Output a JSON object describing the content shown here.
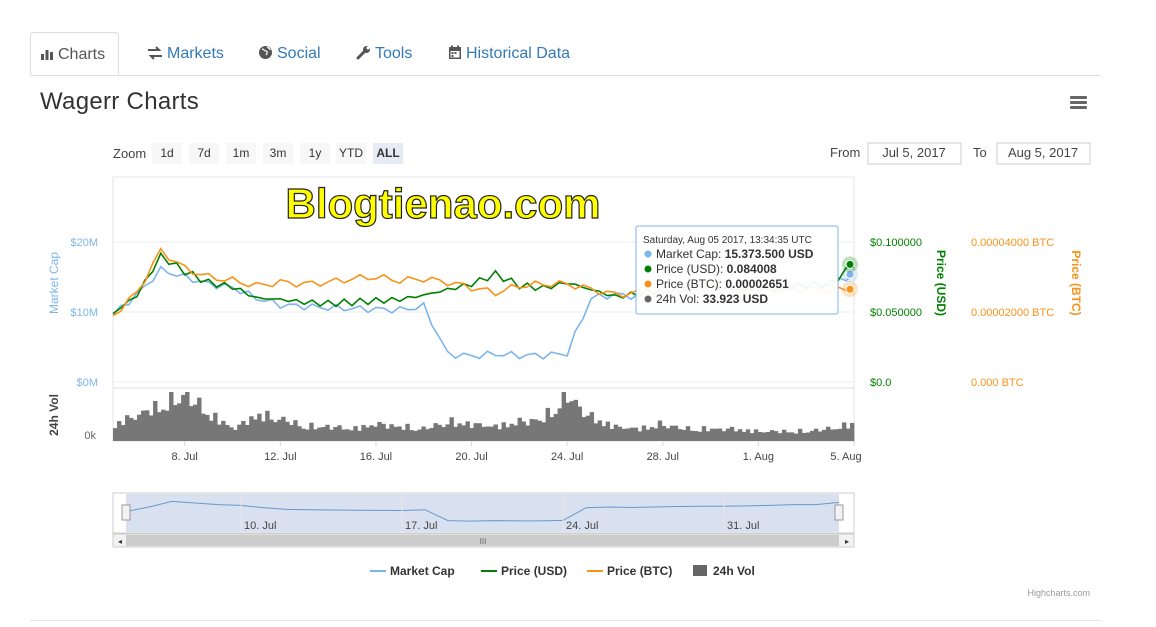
{
  "tabs": [
    {
      "label": "Charts",
      "icon": "bar-chart-icon",
      "active": true
    },
    {
      "label": "Markets",
      "icon": "exchange-arrows-icon",
      "active": false
    },
    {
      "label": "Social",
      "icon": "globe-icon",
      "active": false
    },
    {
      "label": "Tools",
      "icon": "wrench-icon",
      "active": false
    },
    {
      "label": "Historical Data",
      "icon": "calendar-icon",
      "active": false
    }
  ],
  "title": "Wagerr Charts",
  "zoom": {
    "label": "Zoom",
    "buttons": [
      "1d",
      "7d",
      "1m",
      "3m",
      "1y",
      "YTD",
      "ALL"
    ],
    "selected": "ALL"
  },
  "range": {
    "from_label": "From",
    "from_value": "Jul 5, 2017",
    "to_label": "To",
    "to_value": "Aug 5, 2017"
  },
  "watermark": "Blogtienao.com",
  "credit": "Highcharts.com",
  "colors": {
    "market_cap": "#7cb5ec",
    "price_usd": "#008000",
    "price_btc": "#f7931a",
    "volume": "#777777",
    "navigator": "#6699cc"
  },
  "tooltip": {
    "header": "Saturday, Aug 05 2017, 13:34:35 UTC",
    "rows": [
      {
        "label": "Market Cap:",
        "value": "15.373.500 USD",
        "color": "#7cb5ec"
      },
      {
        "label": "Price (USD):",
        "value": "0.084008",
        "color": "#008000"
      },
      {
        "label": "Price (BTC):",
        "value": "0.00002651",
        "color": "#f7931a"
      },
      {
        "label": "24h Vol:",
        "value": "33.923 USD",
        "color": "#666666"
      }
    ]
  },
  "chart_data": {
    "type": "line",
    "x_axis": {
      "ticks": [
        "8. Jul",
        "12. Jul",
        "16. Jul",
        "20. Jul",
        "24. Jul",
        "28. Jul",
        "1. Aug",
        "5. Aug"
      ]
    },
    "navigator_ticks": [
      "10. Jul",
      "17. Jul",
      "24. Jul",
      "31. Jul"
    ],
    "y_axes": [
      {
        "title": "Market Cap",
        "ticks": [
          "$0M",
          "$10M",
          "$20M"
        ],
        "range": [
          0,
          20000000
        ]
      },
      {
        "title": "Price (USD)",
        "ticks": [
          "$0.0",
          "$0.050000",
          "$0.100000"
        ],
        "range": [
          0,
          0.1
        ]
      },
      {
        "title": "Price (BTC)",
        "ticks": [
          "0.000 BTC",
          "0.00002000 BTC",
          "0.00004000 BTC"
        ],
        "range": [
          0,
          4e-05
        ]
      },
      {
        "title": "24h Vol",
        "ticks": [
          "0k"
        ]
      }
    ],
    "x": [
      "Jul 5",
      "Jul 6",
      "Jul 7",
      "Jul 8",
      "Jul 9",
      "Jul 10",
      "Jul 11",
      "Jul 12",
      "Jul 13",
      "Jul 14",
      "Jul 15",
      "Jul 16",
      "Jul 17",
      "Jul 18",
      "Jul 19",
      "Jul 20",
      "Jul 21",
      "Jul 22",
      "Jul 23",
      "Jul 24",
      "Jul 25",
      "Jul 26",
      "Jul 27",
      "Jul 28",
      "Jul 29",
      "Jul 30",
      "Jul 31",
      "Aug 1",
      "Aug 2",
      "Aug 3",
      "Aug 4",
      "Aug 5"
    ],
    "series": [
      {
        "name": "Market Cap",
        "axis": 0,
        "values": [
          9600000,
          12500000,
          16000000,
          15000000,
          14000000,
          13500000,
          12000000,
          11000000,
          10800000,
          10600000,
          10500000,
          10400000,
          10300000,
          10800000,
          4000000,
          3700000,
          4000000,
          3800000,
          3800000,
          4100000,
          12000000,
          12500000,
          12200000,
          12500000,
          12800000,
          13000000,
          13000000,
          13200000,
          13500000,
          14000000,
          14000000,
          15373500
        ]
      },
      {
        "name": "Price (USD)",
        "axis": 1,
        "values": [
          0.049,
          0.062,
          0.09,
          0.079,
          0.071,
          0.068,
          0.06,
          0.059,
          0.057,
          0.056,
          0.057,
          0.058,
          0.059,
          0.062,
          0.066,
          0.07,
          0.077,
          0.069,
          0.067,
          0.071,
          0.066,
          0.061,
          0.063,
          0.066,
          0.067,
          0.068,
          0.066,
          0.066,
          0.067,
          0.069,
          0.07,
          0.084008
        ]
      },
      {
        "name": "Price (BTC)",
        "axis": 2,
        "values": [
          1.9e-05,
          2.55e-05,
          3.75e-05,
          3.25e-05,
          3e-05,
          2.9e-05,
          2.75e-05,
          2.85e-05,
          2.8e-05,
          2.85e-05,
          2.95e-05,
          3e-05,
          2.9e-05,
          2.95e-05,
          2.85e-05,
          2.7e-05,
          2.55e-05,
          2.75e-05,
          2.8e-05,
          2.8e-05,
          2.65e-05,
          2.5e-05,
          2.55e-05,
          2.65e-05,
          2.65e-05,
          2.7e-05,
          2.7e-05,
          2.65e-05,
          2.65e-05,
          2.65e-05,
          2.6e-05,
          2.651e-05
        ]
      },
      {
        "name": "24h Vol",
        "axis": 3,
        "values": [
          0.35,
          0.55,
          0.75,
          0.95,
          0.55,
          0.25,
          0.55,
          0.45,
          0.3,
          0.3,
          0.25,
          0.35,
          0.3,
          0.25,
          0.4,
          0.35,
          0.3,
          0.4,
          0.45,
          0.95,
          0.5,
          0.3,
          0.25,
          0.35,
          0.25,
          0.25,
          0.25,
          0.2,
          0.2,
          0.2,
          0.25,
          0.35
        ]
      }
    ],
    "legend": {
      "position": "bottom"
    },
    "grid": true
  }
}
